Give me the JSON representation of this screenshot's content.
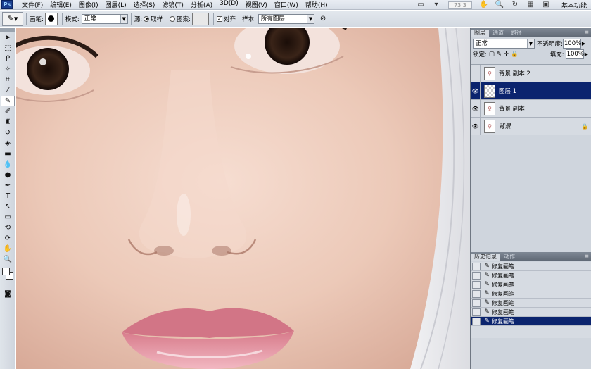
{
  "menubar": {
    "logo": "Ps",
    "menus": [
      "文件(F)",
      "编辑(E)",
      "图像(I)",
      "图层(L)",
      "选择(S)",
      "滤镜(T)",
      "分析(A)",
      "3D(D)",
      "视图(V)",
      "窗口(W)",
      "帮助(H)"
    ],
    "zoom": "73.3",
    "workspace": "基本功能"
  },
  "options": {
    "brush_label": "画笔:",
    "mode_label": "模式:",
    "mode_value": "正常",
    "source_label": "源:",
    "sampled_label": "取样",
    "pattern_label": "图案:",
    "aligned_label": "对齐",
    "sample_label": "样本:",
    "sample_value": "所有图层"
  },
  "layers_panel": {
    "tabs": [
      "图层",
      "通道",
      "路径"
    ],
    "blend_mode": "正常",
    "opacity_label": "不透明度:",
    "opacity_value": "100%",
    "lock_label": "锁定:",
    "fill_label": "填充:",
    "fill_value": "100%",
    "layers": [
      {
        "name": "背景 副本 2",
        "visible": false,
        "selected": false
      },
      {
        "name": "图层 1",
        "visible": true,
        "selected": true
      },
      {
        "name": "背景 副本",
        "visible": true,
        "selected": false
      },
      {
        "name": "背景",
        "visible": true,
        "selected": false,
        "locked": true
      }
    ]
  },
  "history_panel": {
    "tabs": [
      "历史记录",
      "动作"
    ],
    "items": [
      "修复画笔",
      "修复画笔",
      "修复画笔",
      "修复画笔",
      "修复画笔",
      "修复画笔",
      "修复画笔"
    ],
    "selected_index": 6
  },
  "colors": {
    "selection": "#0b246e",
    "panel": "#cfd5dd"
  }
}
